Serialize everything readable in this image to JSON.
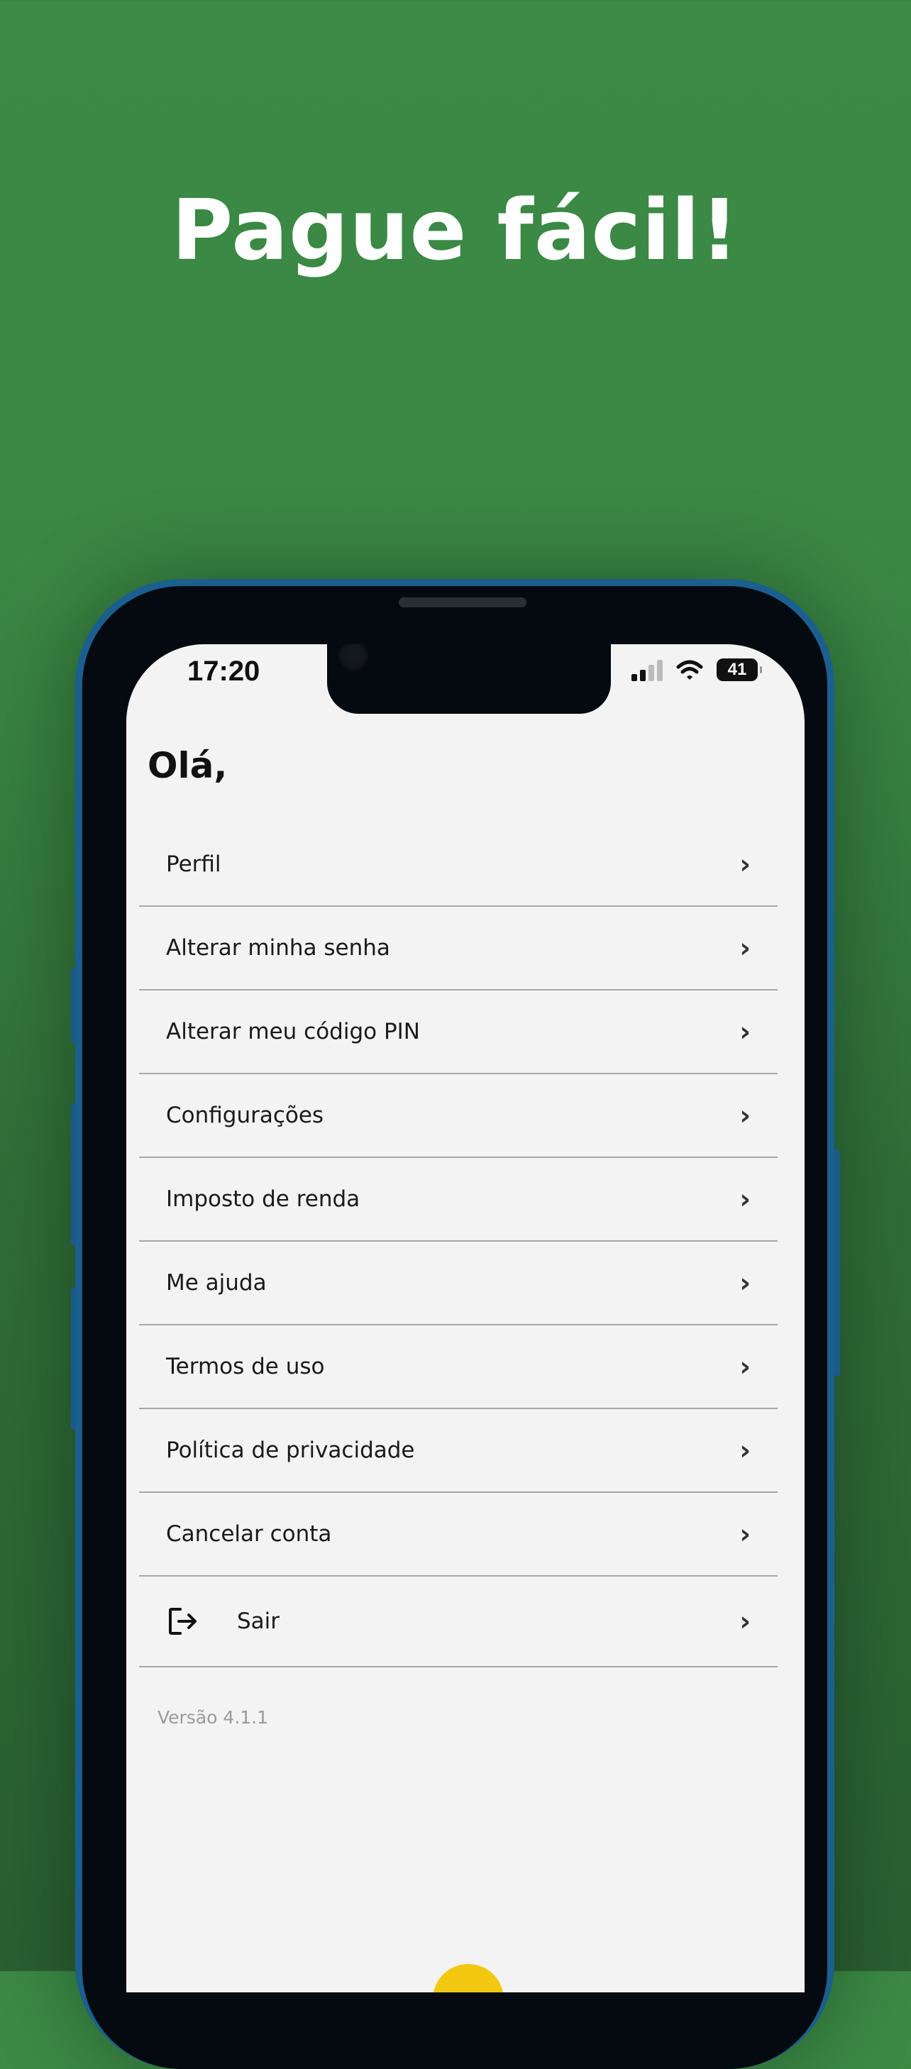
{
  "headline": "Pague fácil!",
  "status_bar": {
    "time": "17:20",
    "battery": "41"
  },
  "greeting": "Olá,",
  "menu": {
    "items": [
      {
        "label": "Perfil"
      },
      {
        "label": "Alterar minha senha"
      },
      {
        "label": "Alterar meu código PIN"
      },
      {
        "label": "Configurações"
      },
      {
        "label": "Imposto de renda"
      },
      {
        "label": "Me ajuda"
      },
      {
        "label": "Termos de uso"
      },
      {
        "label": "Política de privacidade"
      },
      {
        "label": "Cancelar conta"
      }
    ],
    "logout_label": "Sair",
    "chevron": "›"
  },
  "version": "Versão 4.1.1",
  "colors": {
    "background": "#3b8a45",
    "screen": "#f3f3f3",
    "accent": "#f2c811"
  },
  "icons": {
    "signal": "cellular-signal-icon",
    "wifi": "wifi-icon",
    "battery": "battery-icon",
    "logout": "logout-icon",
    "chevron": "chevron-right-icon"
  }
}
